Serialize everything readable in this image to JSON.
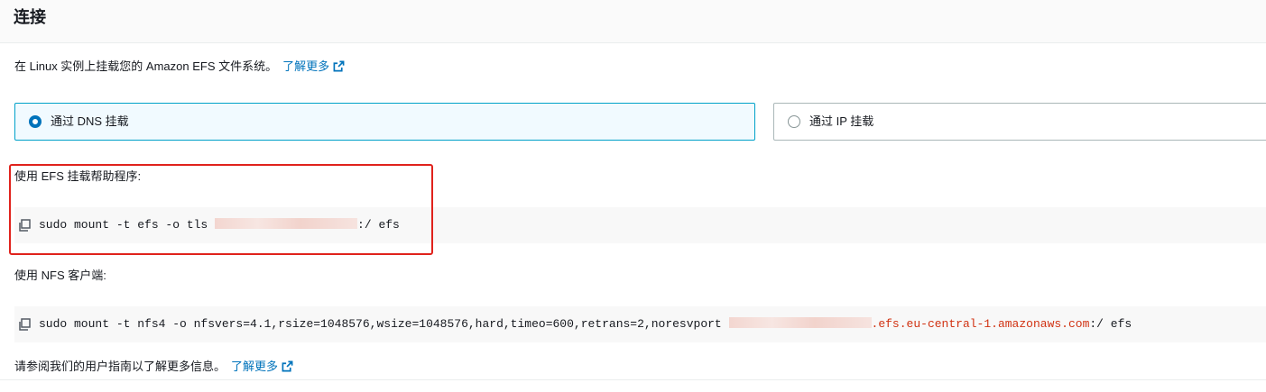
{
  "header": {
    "title": "连接"
  },
  "intro": {
    "text": "在 Linux 实例上挂载您的 Amazon EFS 文件系统。",
    "link_label": "了解更多"
  },
  "mount_options": [
    {
      "label": "通过 DNS 挂载",
      "selected": true
    },
    {
      "label": "通过 IP 挂载",
      "selected": false
    }
  ],
  "efs_helper": {
    "heading": "使用 EFS 挂载帮助程序:",
    "command_prefix": "sudo mount -t efs -o tls ",
    "command_suffix": ":/ efs"
  },
  "nfs_client": {
    "heading": "使用 NFS 客户端:",
    "command_prefix": "sudo mount -t nfs4 -o nfsvers=4.1,rsize=1048576,wsize=1048576,hard,timeo=600,retrans=2,noresvport ",
    "command_domain": ".efs.eu-central-1.amazonaws.com",
    "command_suffix": ":/ efs"
  },
  "footer": {
    "text": "请参阅我们的用户指南以了解更多信息。",
    "link_label": "了解更多"
  },
  "colors": {
    "link": "#0073bb",
    "selected_border": "#00a1c9",
    "highlight_box": "#e0221c",
    "domain_text": "#d13212"
  },
  "icons": {
    "copy": "copy-icon",
    "external": "external-link-icon"
  }
}
